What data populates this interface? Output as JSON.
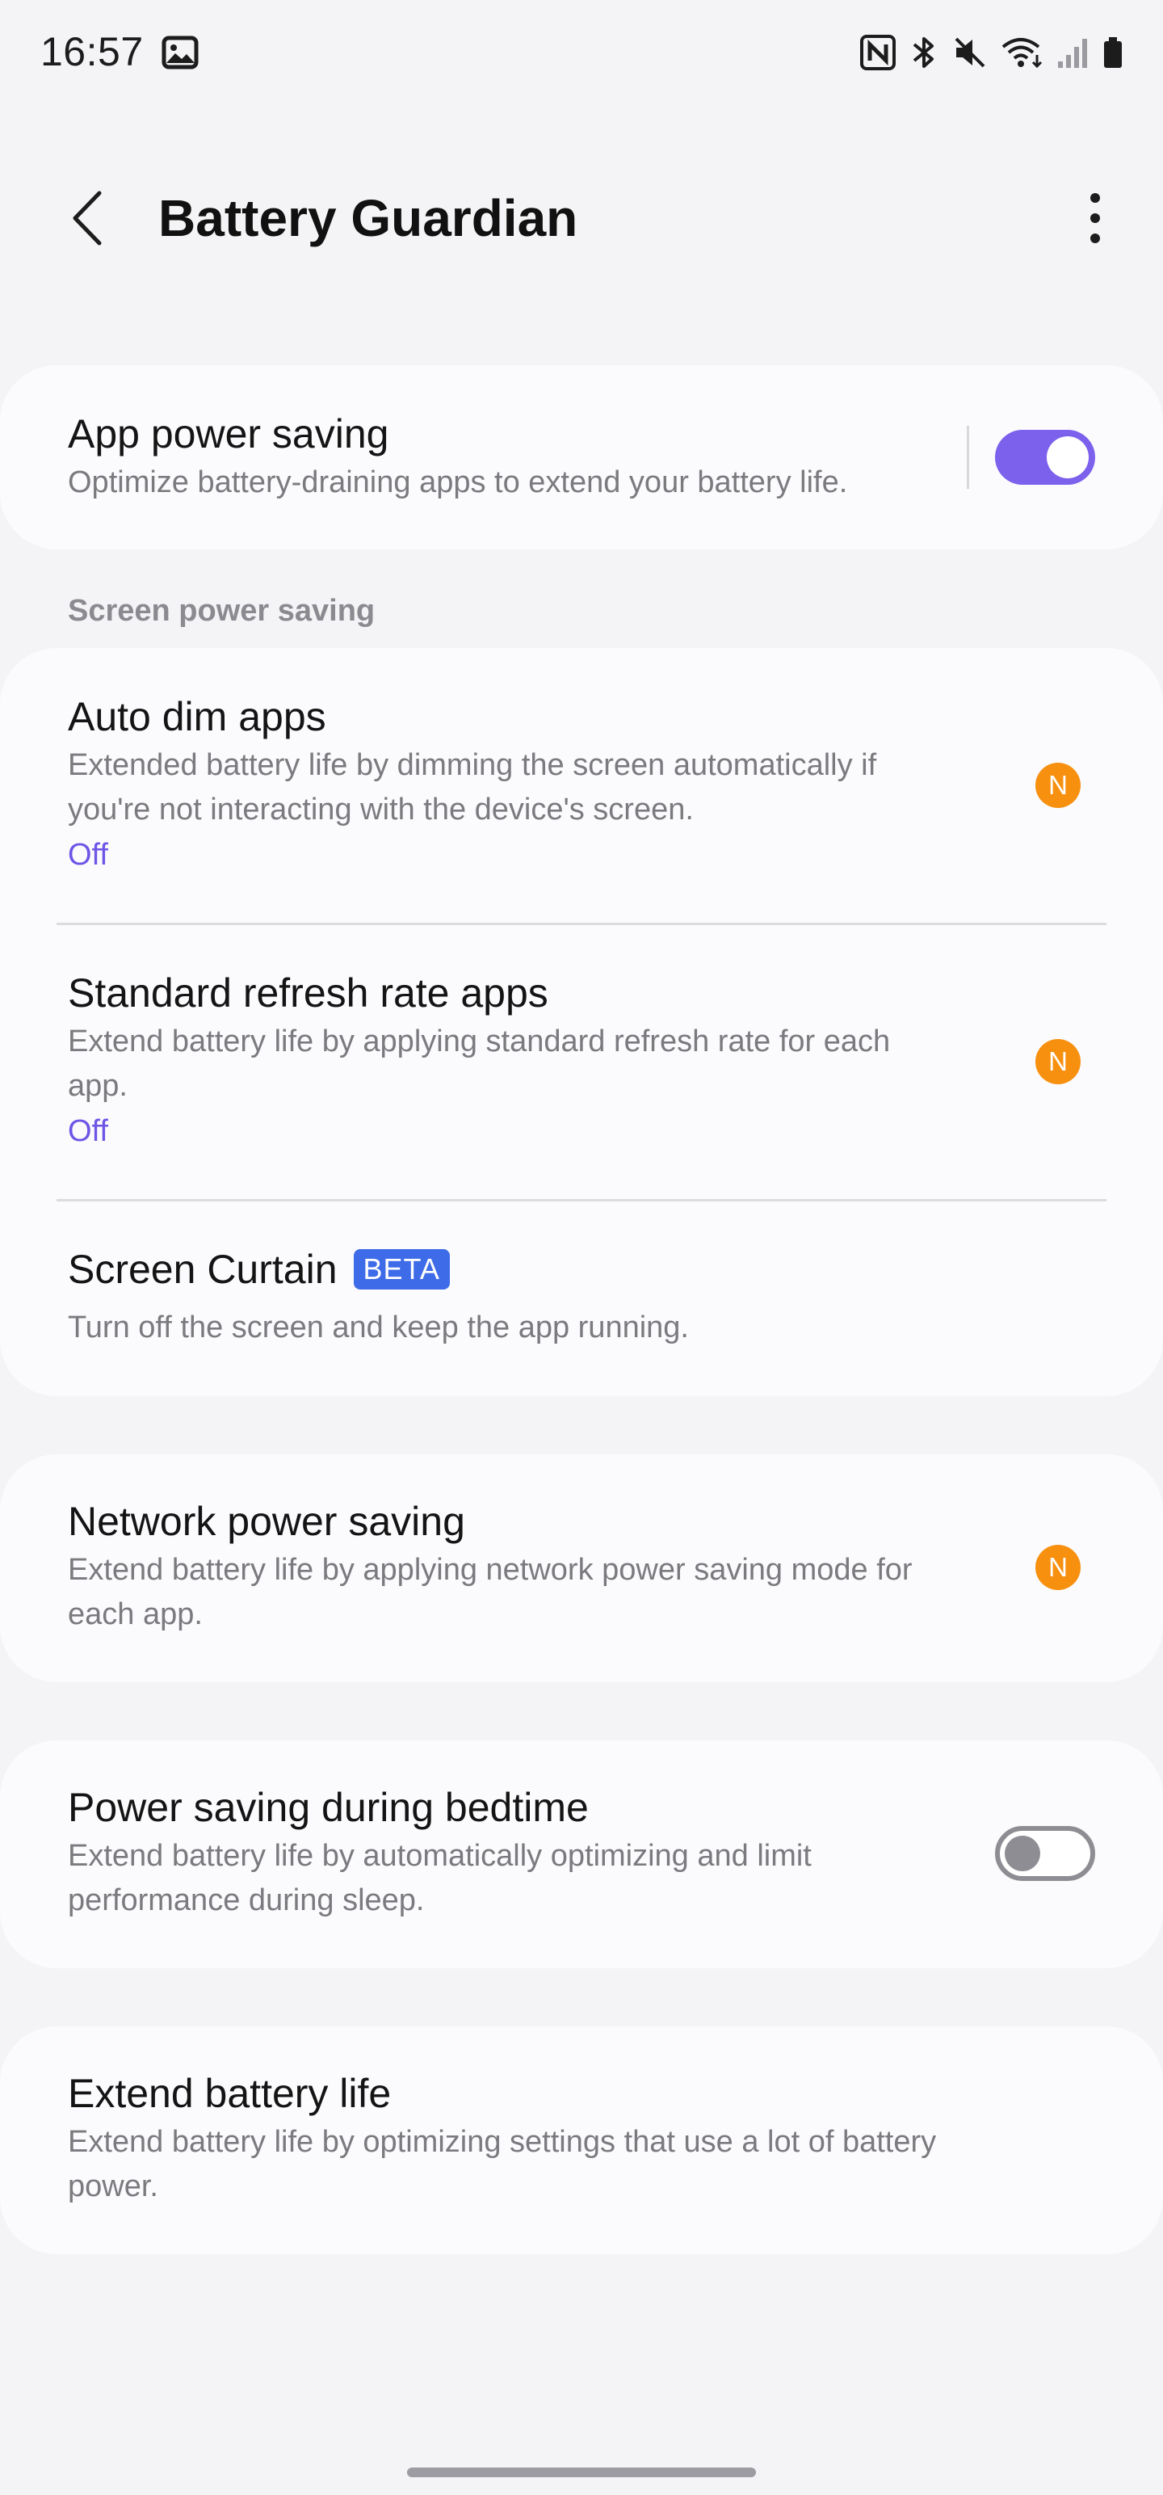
{
  "status_bar": {
    "time": "16:57",
    "icons": [
      "gallery-icon",
      "nfc-icon",
      "bluetooth-icon",
      "mute-icon",
      "wifi-icon",
      "signal-icon",
      "battery-icon"
    ]
  },
  "app_bar": {
    "title": "Battery Guardian",
    "back_icon": "chevron-left-icon",
    "more_icon": "more-vertical-icon"
  },
  "app_power_saving": {
    "title": "App power saving",
    "subtitle": "Optimize battery-draining apps to extend your battery life.",
    "enabled": true
  },
  "screen_section": {
    "header": "Screen power saving",
    "items": [
      {
        "title": "Auto dim apps",
        "subtitle_line1": "Extended battery life by dimming the screen automatically if",
        "subtitle_line2": "you're not interacting with the device's screen.",
        "state": "Off",
        "badge": "N"
      },
      {
        "title": "Standard refresh rate apps",
        "subtitle_line1": "Extend battery life by applying standard refresh rate for each",
        "subtitle_line2": "app.",
        "state": "Off",
        "badge": "N"
      },
      {
        "title": "Screen Curtain",
        "beta": "BETA",
        "subtitle": "Turn off the screen and keep the app running."
      }
    ]
  },
  "network_power_saving": {
    "title": "Network power saving",
    "subtitle_line1": "Extend battery life by applying network power saving mode for",
    "subtitle_line2": "each app.",
    "badge": "N"
  },
  "bedtime": {
    "title": "Power saving during bedtime",
    "subtitle_line1": "Extend battery life by automatically optimizing and limit",
    "subtitle_line2": "performance during sleep.",
    "enabled": false
  },
  "extend_battery": {
    "title": "Extend battery life",
    "subtitle_line1": "Extend battery life by optimizing settings that use a lot of battery",
    "subtitle_line2": "power."
  },
  "colors": {
    "accent": "#7b61ec",
    "state_text": "#6f55e6",
    "badge_orange": "#f7900f",
    "beta_blue": "#3e6be8",
    "background": "#f4f4f6",
    "card": "#fbfbfd"
  }
}
